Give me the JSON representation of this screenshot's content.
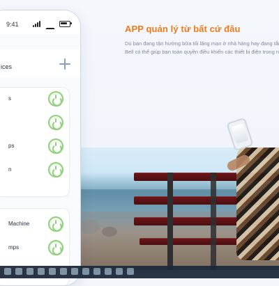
{
  "promo": {
    "title": "APP quản lý từ bất cứ đâu",
    "desc_lines": [
      "Dù bạn đang tận hưởng bữa tối lãng mạn ở nhà hàng hay đang tắm",
      "Bell có thể giúp bạn toàn quyền điều khiển các thiết bị điện trong nh"
    ]
  },
  "phone": {
    "status": {
      "time": "9:41"
    },
    "header": {
      "title": "ices"
    },
    "card1": {
      "rows": [
        {
          "label": "s"
        },
        {
          "label": ""
        },
        {
          "label": "ps"
        },
        {
          "label": "n"
        }
      ]
    },
    "card2": {
      "rows": [
        {
          "label": "Machine"
        },
        {
          "label": "mps"
        }
      ]
    }
  },
  "taskbar": {
    "icons": [
      "start-icon",
      "search-icon",
      "chrome-icon",
      "edge-icon",
      "file-explorer-icon",
      "store-icon",
      "photos-icon",
      "calendar-icon",
      "settings-icon",
      "mail-icon",
      "teams-icon",
      "terminal-icon"
    ]
  }
}
